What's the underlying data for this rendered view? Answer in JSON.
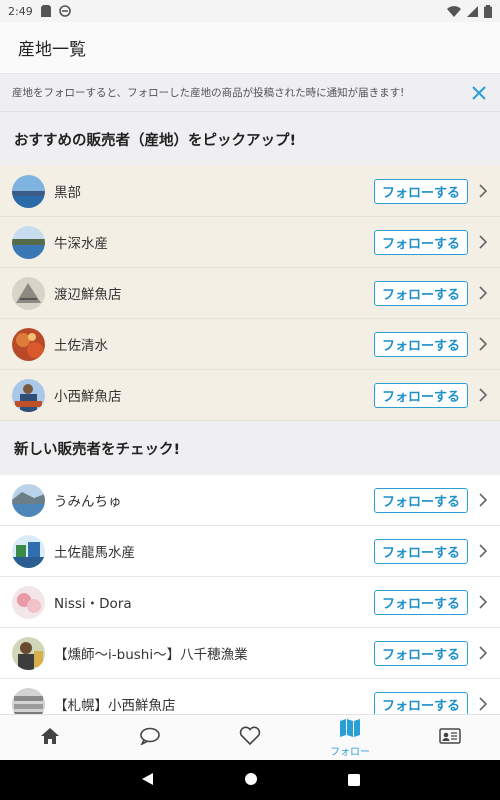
{
  "status_bar": {
    "time": "2:49"
  },
  "app_bar": {
    "title": "産地一覧"
  },
  "notice": {
    "text": "産地をフォローすると、フォローした産地の商品が投稿された時に通知が届きます!"
  },
  "picked": {
    "title": "おすすめの販売者（産地）をピックアップ!",
    "items": [
      {
        "name": "黒部",
        "button": "フォローする"
      },
      {
        "name": "牛深水産",
        "button": "フォローする"
      },
      {
        "name": "渡辺鮮魚店",
        "button": "フォローする"
      },
      {
        "name": "土佐清水",
        "button": "フォローする"
      },
      {
        "name": "小西鮮魚店",
        "button": "フォローする"
      }
    ]
  },
  "new": {
    "title": "新しい販売者をチェック!",
    "items": [
      {
        "name": "うみんちゅ",
        "button": "フォローする"
      },
      {
        "name": "土佐龍馬水産",
        "button": "フォローする"
      },
      {
        "name": "Nissi・Dora",
        "button": "フォローする"
      },
      {
        "name": "【燻師〜i-bushi〜】八千穂漁業",
        "button": "フォローする"
      },
      {
        "name": "【札幌】小西鮮魚店",
        "button": "フォローする"
      }
    ]
  },
  "bottom_nav": {
    "items": [
      {
        "icon": "home-icon"
      },
      {
        "icon": "chat-icon"
      },
      {
        "icon": "heart-icon"
      },
      {
        "icon": "map-icon",
        "label": "フォロー",
        "active": true
      },
      {
        "icon": "profile-card-icon"
      }
    ]
  },
  "colors": {
    "accent": "#2a9fd6",
    "picked_bg": "#f3efe4"
  }
}
